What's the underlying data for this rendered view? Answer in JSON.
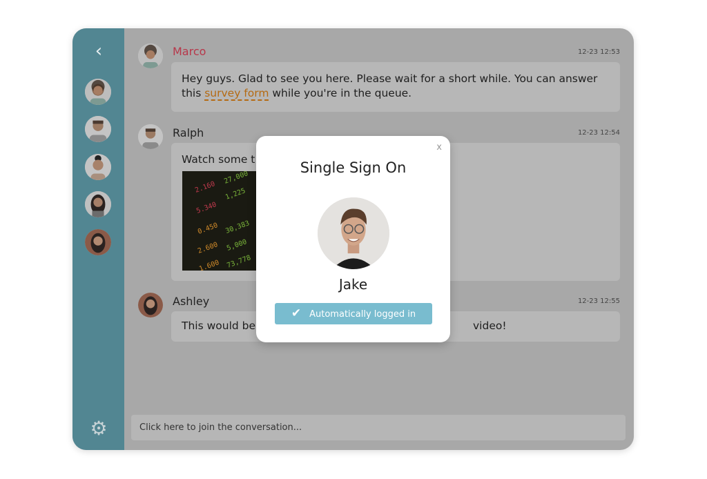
{
  "sidebar": {
    "back_icon": "chevron-left-icon",
    "settings_icon": "gear-icon",
    "contacts": [
      "Marco",
      "Ralph",
      "Woman with bun",
      "Ashley",
      "Woman at brick wall"
    ]
  },
  "messages": [
    {
      "name": "Marco",
      "time": "12-23 12:53",
      "text_before": "Hey guys. Glad to see you here. Please wait for a short while. You can answer this ",
      "link": "survey form",
      "text_after": " while you're in the queue.",
      "name_color": "#b7374a"
    },
    {
      "name": "Ralph",
      "time": "12-23 12:54",
      "text": "Watch some t",
      "stock_values": [
        "2.160",
        "5.340",
        "0.450",
        "2.600",
        "1.600",
        "1,225",
        "30,383",
        "5,000",
        "73,778",
        "27,000"
      ]
    },
    {
      "name": "Ashley",
      "time": "12-23 12:55",
      "text": "This would be",
      "text_end": "video!"
    }
  ],
  "composer": {
    "placeholder": "Click here to join the conversation..."
  },
  "modal": {
    "close": "x",
    "title": "Single Sign On",
    "user": "Jake",
    "status": "Automatically logged in",
    "check": "✔",
    "accent": "#79bccf"
  }
}
